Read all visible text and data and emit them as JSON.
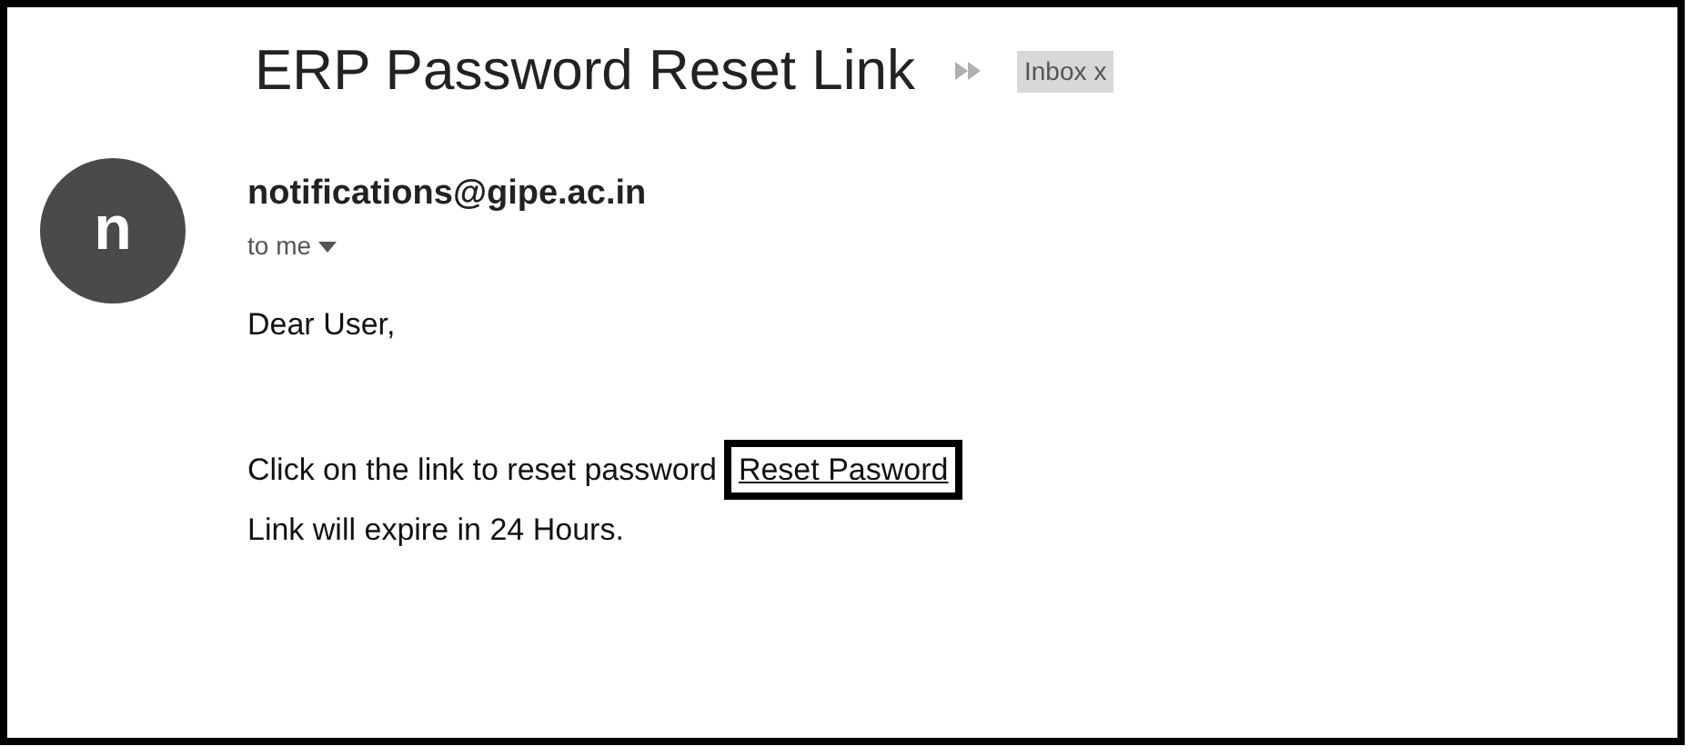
{
  "subject": "ERP Password Reset Link",
  "label": {
    "text": "Inbox",
    "close": "x"
  },
  "avatar_letter": "n",
  "sender": "notifications@gipe.ac.in",
  "recipient": "to me",
  "body": {
    "greeting": "Dear User,",
    "instruction": "Click on the link to reset password",
    "link": "Reset Pasword",
    "expiry": "Link will expire in 24 Hours."
  }
}
